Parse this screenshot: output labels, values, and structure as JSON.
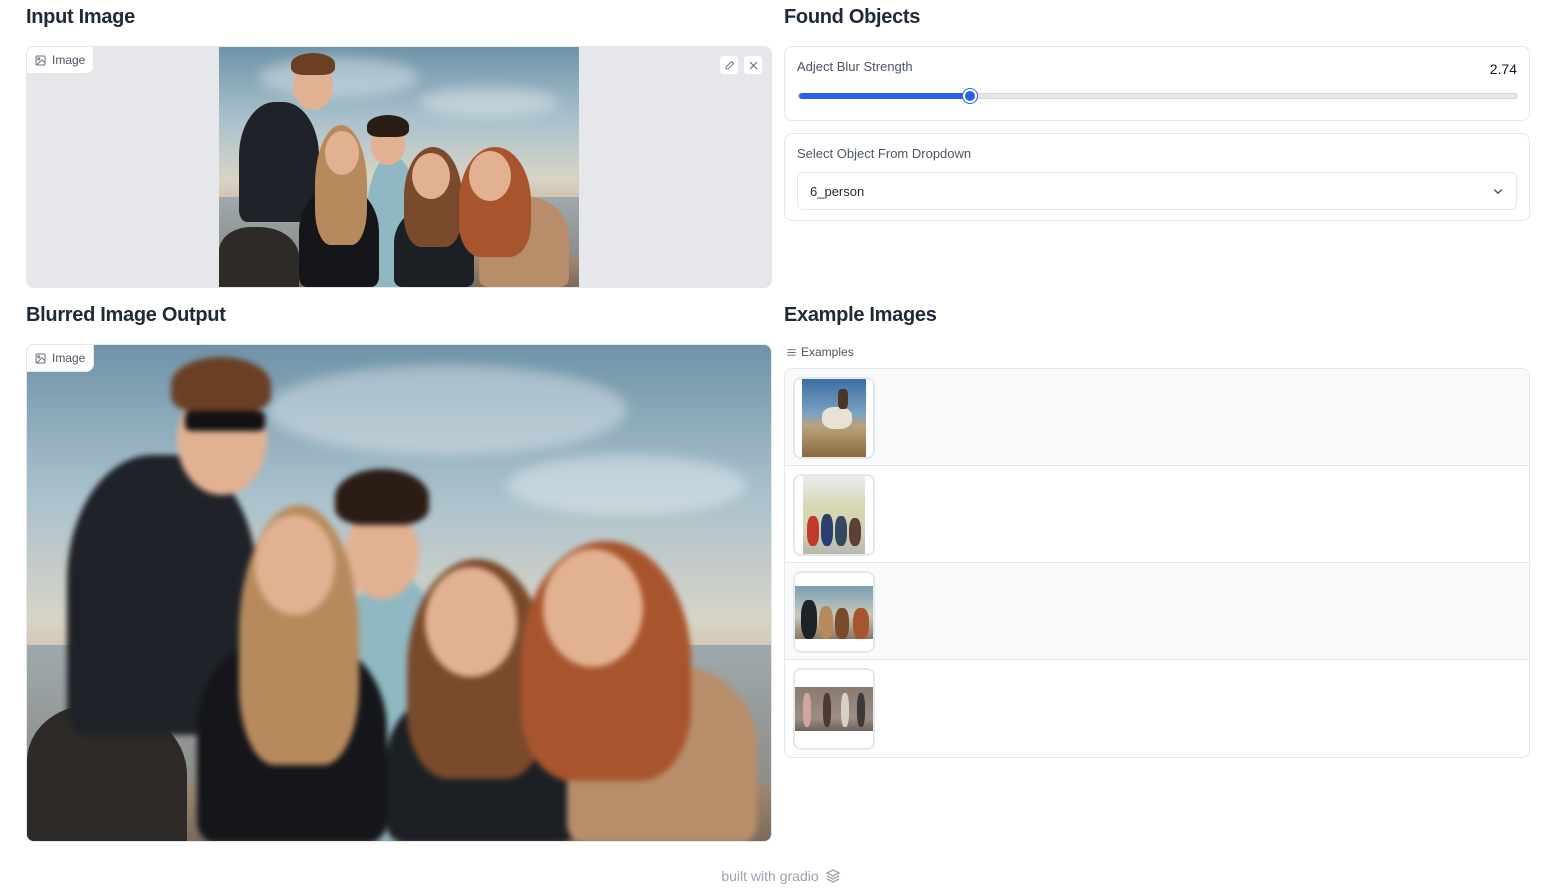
{
  "input_section": {
    "title": "Input Image",
    "image_label": "Image",
    "edit_icon": "pencil-icon",
    "clear_icon": "close-icon"
  },
  "found_section": {
    "title": "Found Objects",
    "slider": {
      "label": "Adject Blur Strength",
      "value": "2.74",
      "fill_fraction": 0.24
    },
    "dropdown": {
      "label": "Select Object From Dropdown",
      "value": "6_person",
      "icon": "chevron-down-icon"
    }
  },
  "output_section": {
    "title": "Blurred Image Output",
    "image_label": "Image"
  },
  "examples_section": {
    "title": "Example Images",
    "label": "Examples",
    "items": [
      "horse-rider-photo",
      "group-park-photo",
      "friends-beach-photo",
      "people-gym-photo"
    ]
  },
  "footer": {
    "text": "built with gradio",
    "icon": "gradio-logo-icon"
  },
  "colors": {
    "accent": "#2563eb",
    "border": "#e5e7eb",
    "panel_bg": "#e5e7eb"
  }
}
